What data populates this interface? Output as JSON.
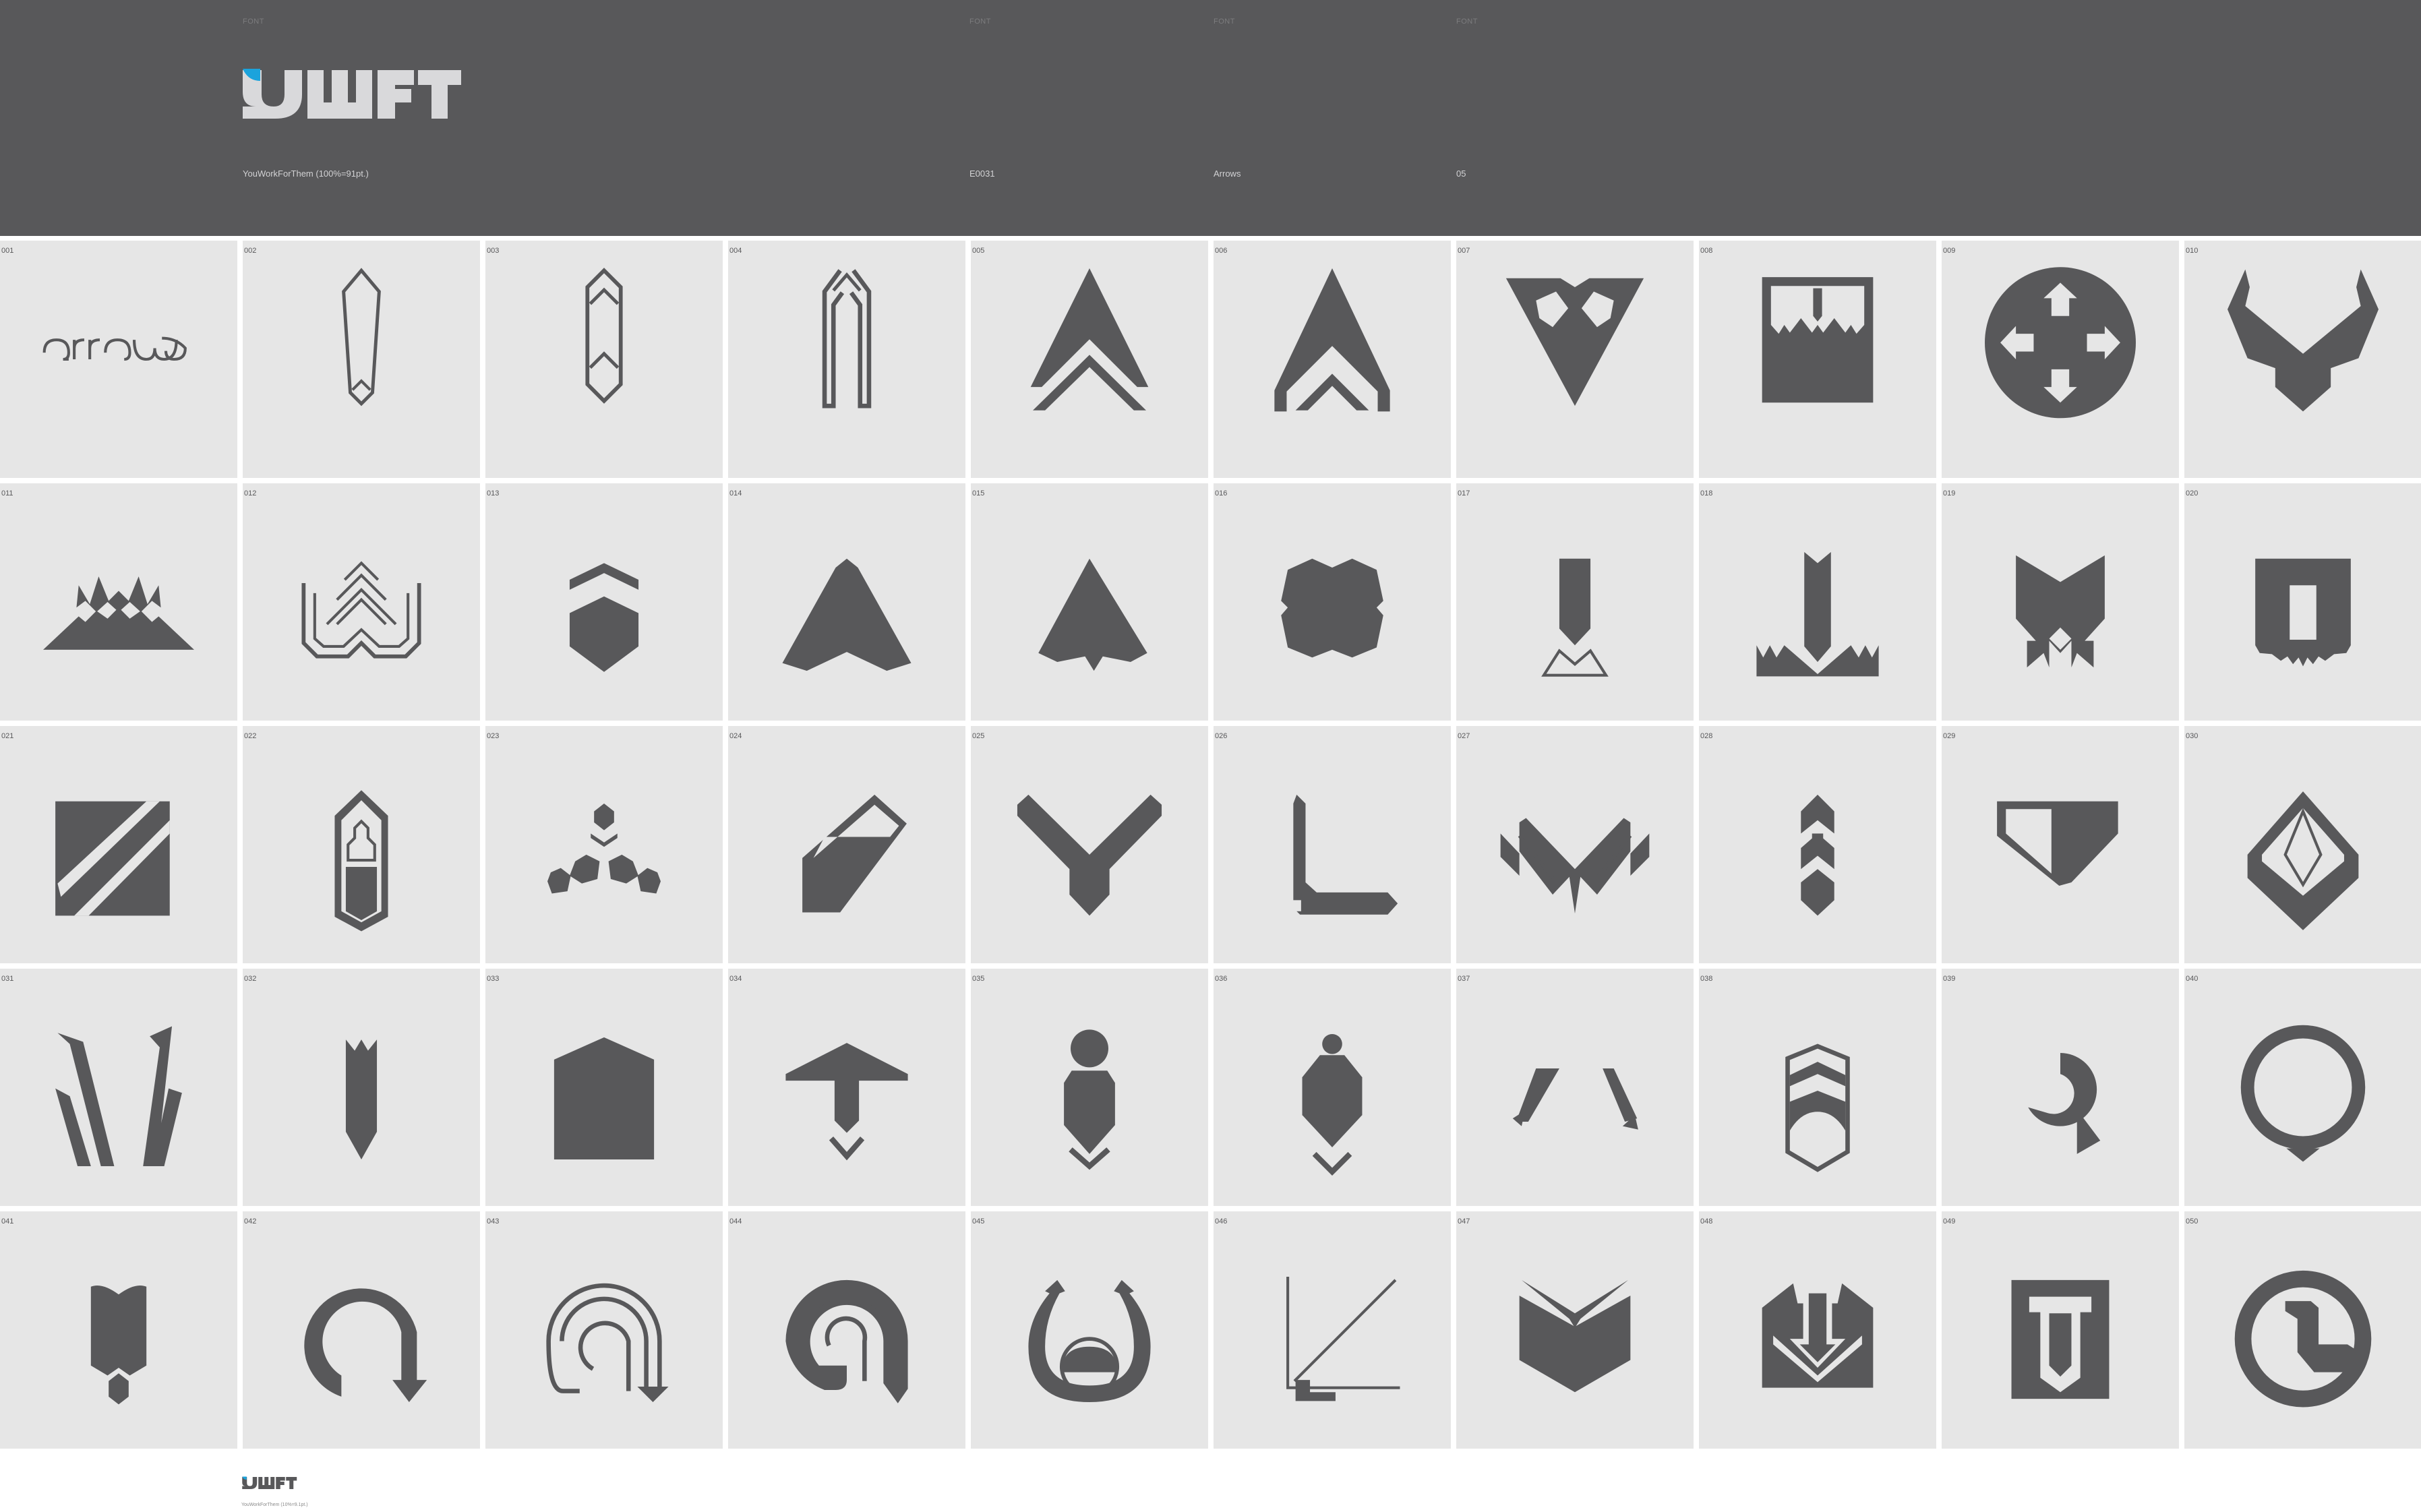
{
  "header": {
    "small_labels": [
      "FONT",
      "FONT",
      "FONT",
      "FONT"
    ],
    "foundry": "YouWorkForThem (100%=91pt.)",
    "code": "E0031",
    "category": "Arrows",
    "volume": "05",
    "brand_color": "#1ba3dc",
    "bg_color": "#58585a"
  },
  "glyphs": [
    {
      "num": "001",
      "icon": "arrow-wordmark-icon"
    },
    {
      "num": "002",
      "icon": "pencil-arrow-icon"
    },
    {
      "num": "003",
      "icon": "crystal-arrow-icon"
    },
    {
      "num": "004",
      "icon": "gothic-arch-arrow-icon"
    },
    {
      "num": "005",
      "icon": "chevron-arrow-icon"
    },
    {
      "num": "006",
      "icon": "split-chevron-arrow-icon"
    },
    {
      "num": "007",
      "icon": "triangle-knot-arrow-icon"
    },
    {
      "num": "008",
      "icon": "crown-box-arrow-icon"
    },
    {
      "num": "009",
      "icon": "circle-cross-arrows-icon"
    },
    {
      "num": "010",
      "icon": "horned-arrow-icon"
    },
    {
      "num": "011",
      "icon": "mountain-arrow-icon"
    },
    {
      "num": "012",
      "icon": "outline-chevrons-arrow-icon"
    },
    {
      "num": "013",
      "icon": "shield-chevron-arrow-icon"
    },
    {
      "num": "014",
      "icon": "kite-arrow-icon"
    },
    {
      "num": "015",
      "icon": "notched-kite-arrow-icon"
    },
    {
      "num": "016",
      "icon": "cross-blob-arrow-icon"
    },
    {
      "num": "017",
      "icon": "down-arrow-crown-icon"
    },
    {
      "num": "018",
      "icon": "down-arrow-spikes-icon"
    },
    {
      "num": "019",
      "icon": "fox-arrow-icon"
    },
    {
      "num": "020",
      "icon": "door-arrow-icon"
    },
    {
      "num": "021",
      "icon": "diagonal-square-arrow-icon"
    },
    {
      "num": "022",
      "icon": "lantern-arrow-icon"
    },
    {
      "num": "023",
      "icon": "hex-cluster-arrow-icon"
    },
    {
      "num": "024",
      "icon": "diagonal-block-arrow-icon"
    },
    {
      "num": "025",
      "icon": "v-arrow-icon"
    },
    {
      "num": "026",
      "icon": "l-arrow-icon"
    },
    {
      "num": "027",
      "icon": "winged-v-arrow-icon"
    },
    {
      "num": "028",
      "icon": "totem-arrow-icon"
    },
    {
      "num": "029",
      "icon": "pentagon-arrow-icon"
    },
    {
      "num": "030",
      "icon": "diamond-tray-arrow-icon"
    },
    {
      "num": "031",
      "icon": "w-arrow-icon"
    },
    {
      "num": "032",
      "icon": "pillar-arrow-icon"
    },
    {
      "num": "033",
      "icon": "house-arrow-icon"
    },
    {
      "num": "034",
      "icon": "t-arrow-icon"
    },
    {
      "num": "035",
      "icon": "figure-arrow-icon"
    },
    {
      "num": "036",
      "icon": "pawn-arrow-icon"
    },
    {
      "num": "037",
      "icon": "caret-pair-arrow-icon"
    },
    {
      "num": "038",
      "icon": "helmet-arrow-icon"
    },
    {
      "num": "039",
      "icon": "refresh-arrow-icon"
    },
    {
      "num": "040",
      "icon": "ring-down-arrow-icon"
    },
    {
      "num": "041",
      "icon": "tulip-arrow-icon"
    },
    {
      "num": "042",
      "icon": "u-turn-arrow-icon"
    },
    {
      "num": "043",
      "icon": "outline-u-turn-arrow-icon"
    },
    {
      "num": "044",
      "icon": "spiral-u-turn-arrow-icon"
    },
    {
      "num": "045",
      "icon": "horseshoe-arrow-icon"
    },
    {
      "num": "046",
      "icon": "diagonal-corner-arrow-icon"
    },
    {
      "num": "047",
      "icon": "envelope-arrow-icon"
    },
    {
      "num": "048",
      "icon": "tray-down-arrow-icon"
    },
    {
      "num": "049",
      "icon": "box-down-arrow-icon"
    },
    {
      "num": "050",
      "icon": "no-entry-arrow-icon"
    }
  ],
  "footer": {
    "caption": "YouWorkForThem (10%=9.1pt.)"
  }
}
